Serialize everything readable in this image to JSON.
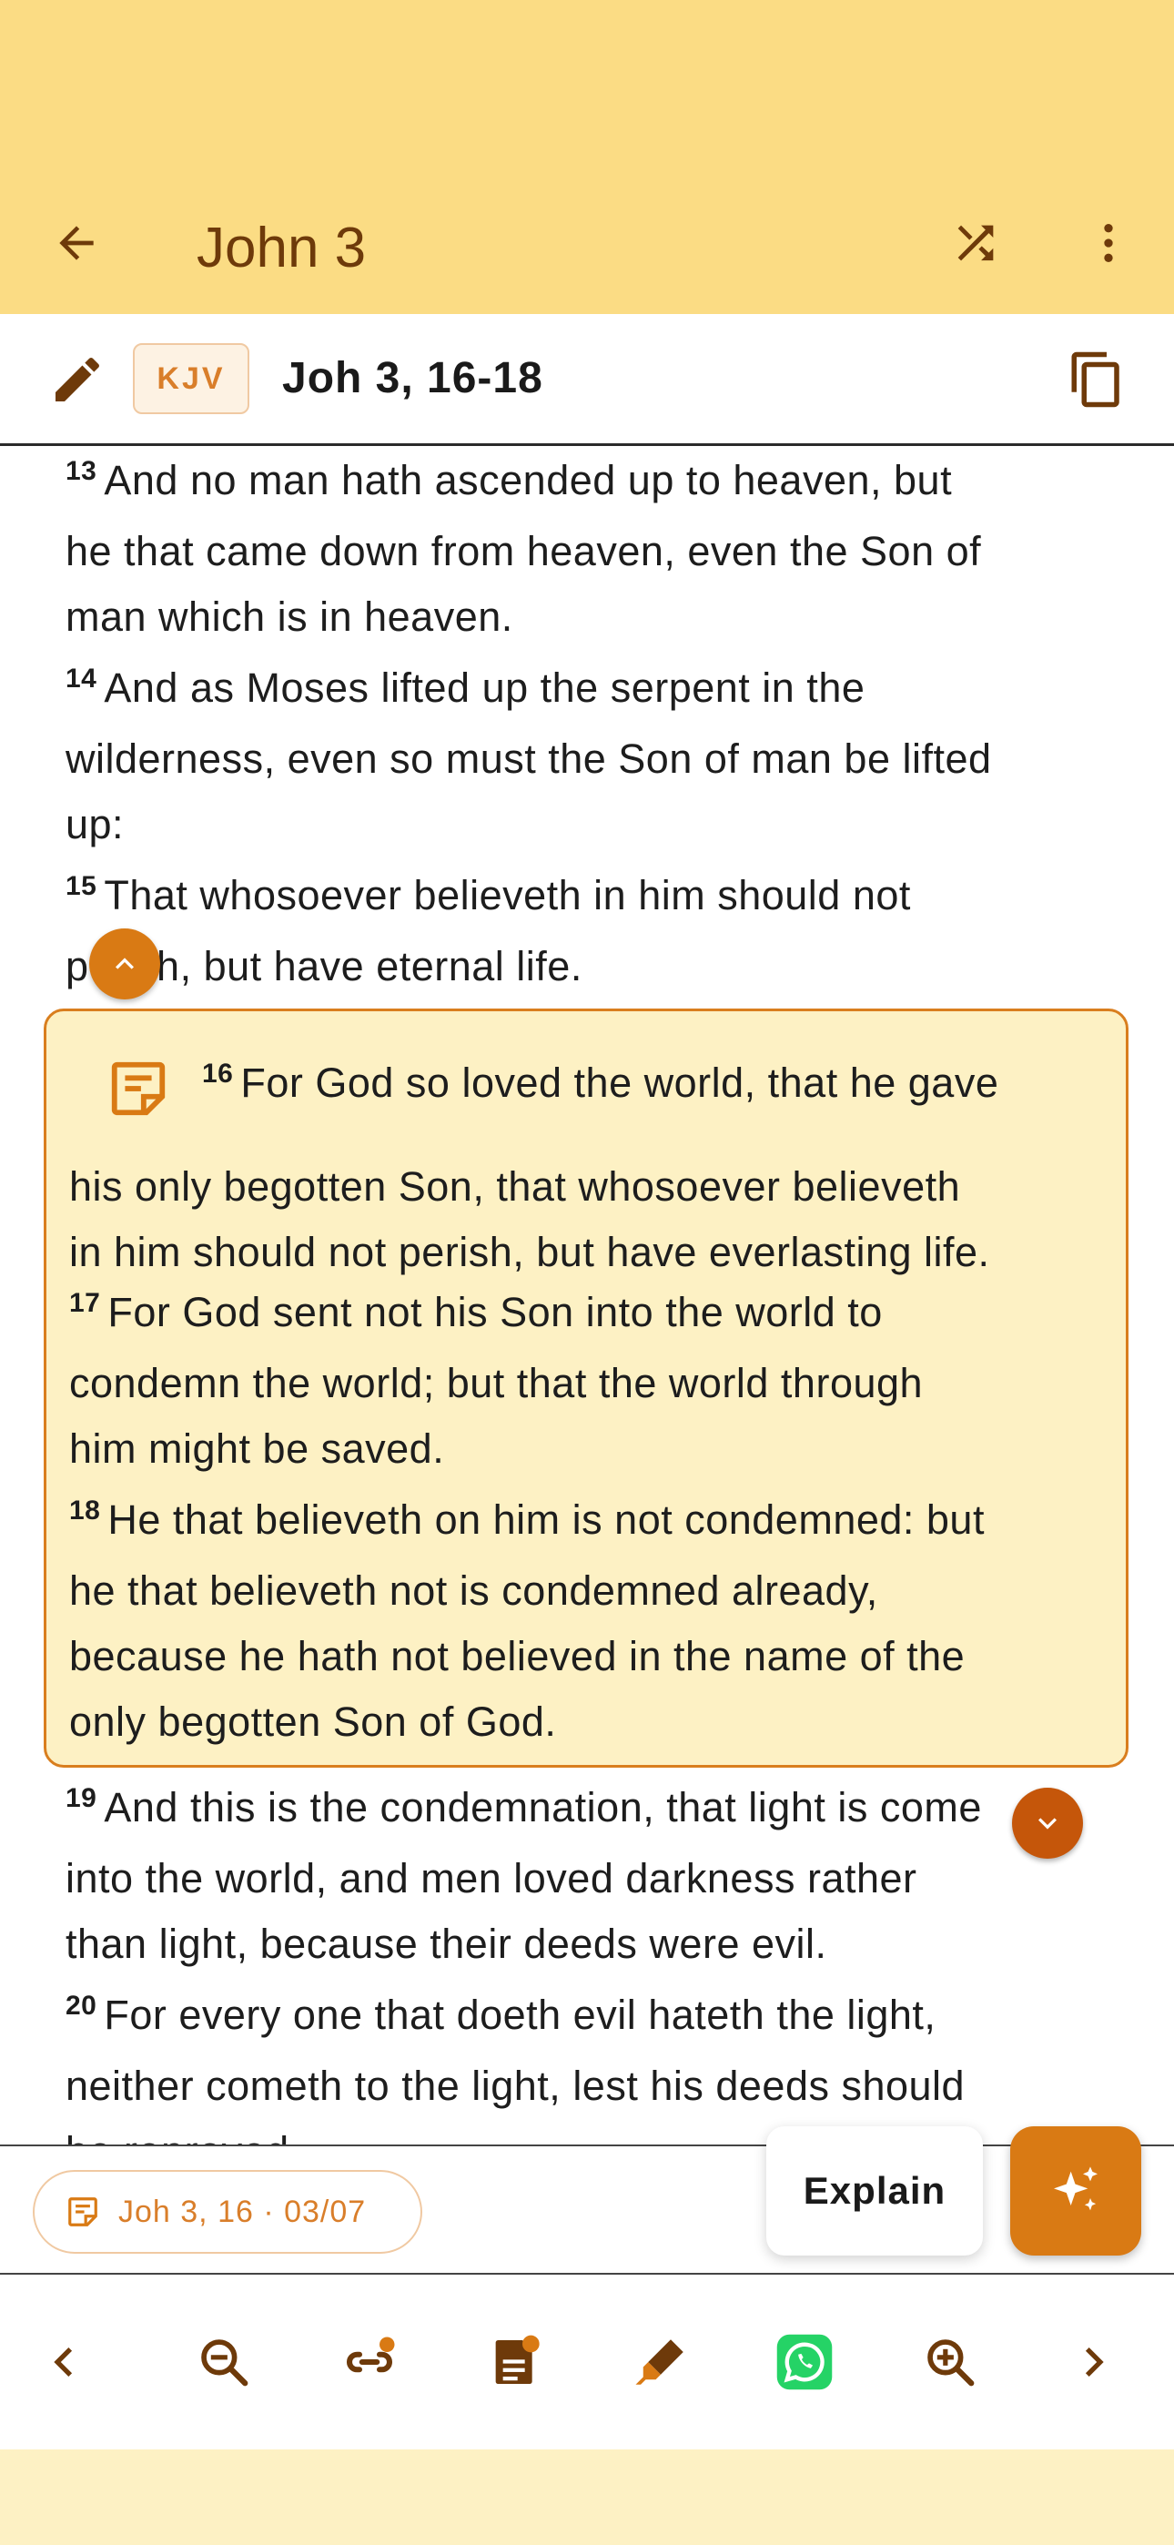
{
  "app_bar": {
    "title": "John 3",
    "icons": {
      "back": "arrow-left-icon",
      "shuffle": "shuffle-icon",
      "more": "more-vert-icon"
    }
  },
  "selection_bar": {
    "version": "KJV",
    "reference": "Joh 3, 16-18",
    "icons": {
      "edit": "pencil-icon",
      "copy": "copy-icon"
    }
  },
  "verses": [
    {
      "num": "13",
      "lines": [
        "And no man hath ascended up to heaven, but",
        "he that came down from heaven, even the Son of",
        "man which is in heaven."
      ]
    },
    {
      "num": "14",
      "lines": [
        "And as Moses lifted up the serpent in the",
        "wilderness, even so must the Son of man be lifted",
        "up:"
      ]
    },
    {
      "num": "15",
      "lines": [
        "That whosoever believeth in him should not",
        "perish, but have eternal life."
      ]
    },
    {
      "num": "16",
      "lines": [
        "For God so loved the world, that he gave",
        "his only begotten Son, that whosoever believeth",
        "in him should not perish, but have everlasting life."
      ]
    },
    {
      "num": "17",
      "lines": [
        "For God sent not his Son into the world to",
        "condemn the world; but that the world through",
        "him might be saved."
      ]
    },
    {
      "num": "18",
      "lines": [
        "He that believeth on him is not condemned: but",
        "he that believeth not is condemned already,",
        "because he hath not believed in the name of the",
        "only begotten Son of God."
      ]
    },
    {
      "num": "19",
      "lines": [
        "And this is the condemnation, that light is come",
        "into the world, and men loved darkness rather",
        "than light, because their deeds were evil."
      ]
    },
    {
      "num": "20",
      "lines": [
        "For every one that doeth evil hateth the light,",
        "neither cometh to the light, lest his deeds should",
        "be reproved."
      ]
    }
  ],
  "bottom_info": {
    "history_chip": "Joh 3, 16 · 03/07",
    "explain_label": "Explain"
  },
  "toolbar": {
    "icons": [
      "chevron-left-icon",
      "zoom-out-icon",
      "link-icon",
      "notes-icon",
      "highlighter-icon",
      "whatsapp-icon",
      "zoom-in-icon",
      "chevron-right-icon"
    ]
  },
  "colors": {
    "app_bar_bg": "#fbdc84",
    "title_color": "#6e3a0a",
    "accent": "#d97a14",
    "selection_bg": "#fdf1c4",
    "whatsapp": "#25d366"
  }
}
